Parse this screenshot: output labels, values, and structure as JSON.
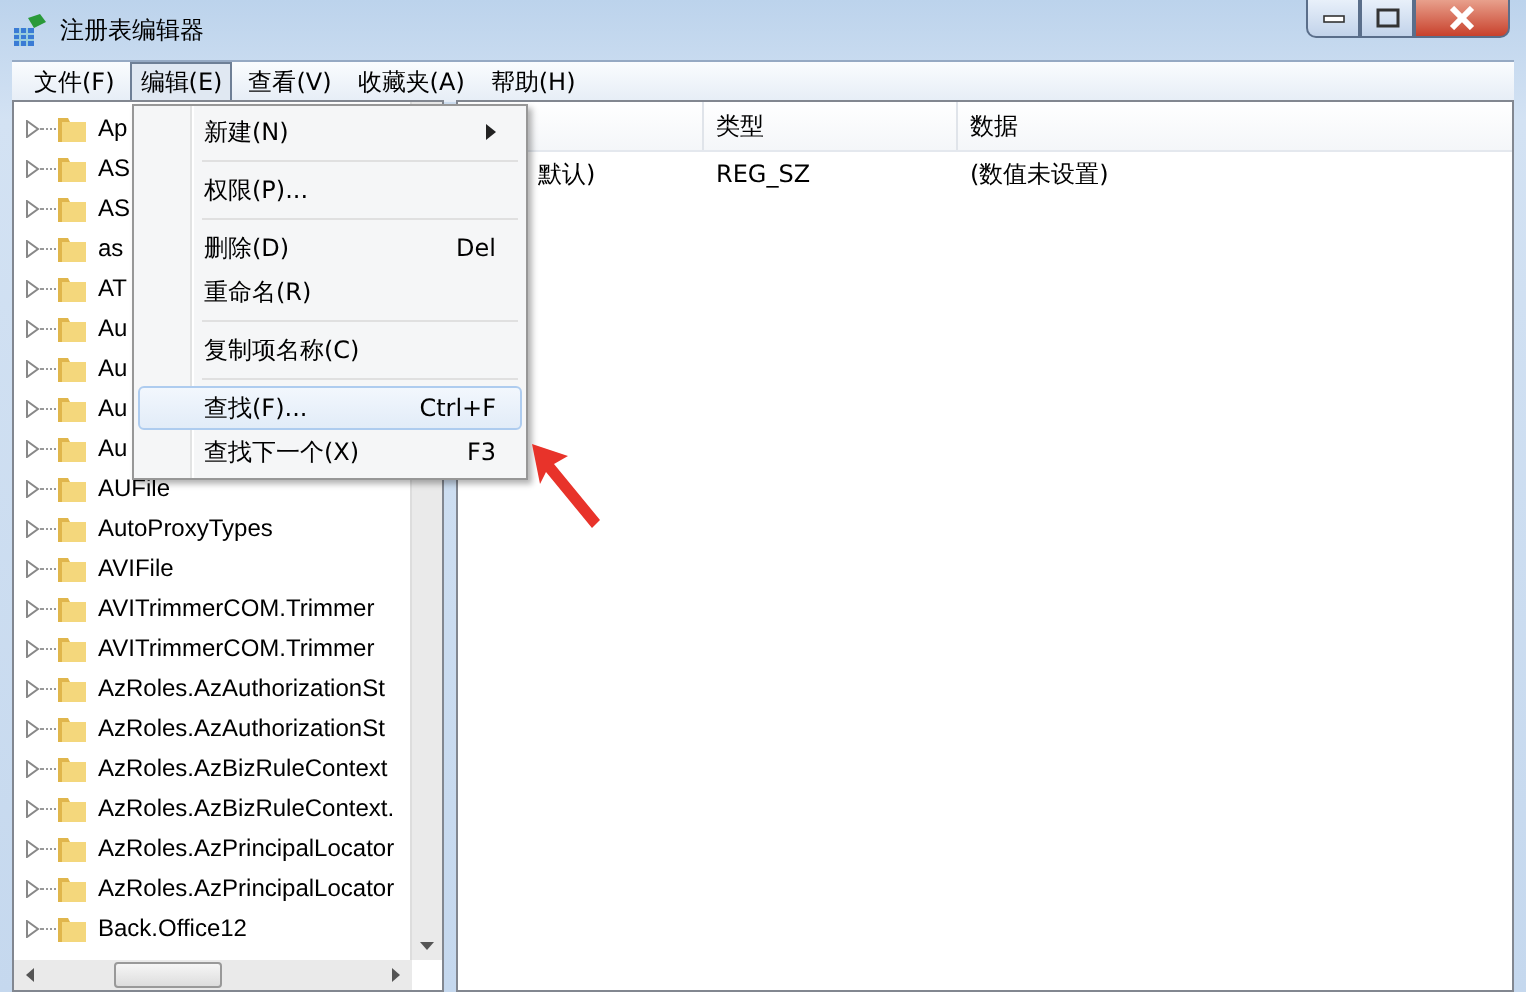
{
  "window": {
    "title": "注册表编辑器"
  },
  "menubar": [
    {
      "label": "文件(F)",
      "selected": false
    },
    {
      "label": "编辑(E)",
      "selected": true
    },
    {
      "label": "查看(V)",
      "selected": false
    },
    {
      "label": "收藏夹(A)",
      "selected": false
    },
    {
      "label": "帮助(H)",
      "selected": false
    }
  ],
  "menu": [
    {
      "kind": "item",
      "label": "新建(N)",
      "submenu": true,
      "selected": false
    },
    {
      "kind": "separator"
    },
    {
      "kind": "item",
      "label": "权限(P)...",
      "selected": false
    },
    {
      "kind": "separator"
    },
    {
      "kind": "item",
      "label": "删除(D)",
      "shortcut": "Del",
      "selected": false
    },
    {
      "kind": "item",
      "label": "重命名(R)",
      "selected": false
    },
    {
      "kind": "separator"
    },
    {
      "kind": "item",
      "label": "复制项名称(C)",
      "selected": false
    },
    {
      "kind": "separator"
    },
    {
      "kind": "item",
      "label": "查找(F)...",
      "shortcut": "Ctrl+F",
      "selected": true
    },
    {
      "kind": "item",
      "label": "查找下一个(X)",
      "shortcut": "F3",
      "selected": false
    }
  ],
  "tree": [
    {
      "label": "Ap"
    },
    {
      "label": "AS"
    },
    {
      "label": "AS"
    },
    {
      "label": "as"
    },
    {
      "label": "AT"
    },
    {
      "label": "Au"
    },
    {
      "label": "Au"
    },
    {
      "label": "Au"
    },
    {
      "label": "Au"
    },
    {
      "label": "AUFile"
    },
    {
      "label": "AutoProxyTypes"
    },
    {
      "label": "AVIFile"
    },
    {
      "label": "AVITrimmerCOM.Trimmer"
    },
    {
      "label": "AVITrimmerCOM.Trimmer"
    },
    {
      "label": "AzRoles.AzAuthorizationSt"
    },
    {
      "label": "AzRoles.AzAuthorizationSt"
    },
    {
      "label": "AzRoles.AzBizRuleContext"
    },
    {
      "label": "AzRoles.AzBizRuleContext."
    },
    {
      "label": "AzRoles.AzPrincipalLocator"
    },
    {
      "label": "AzRoles.AzPrincipalLocator"
    },
    {
      "label": "Back.Office12"
    }
  ],
  "values": {
    "columns": [
      "类型",
      "数据"
    ],
    "rows": [
      {
        "name": "默认)",
        "type": "REG_SZ",
        "data": "(数值未设置)"
      }
    ]
  }
}
